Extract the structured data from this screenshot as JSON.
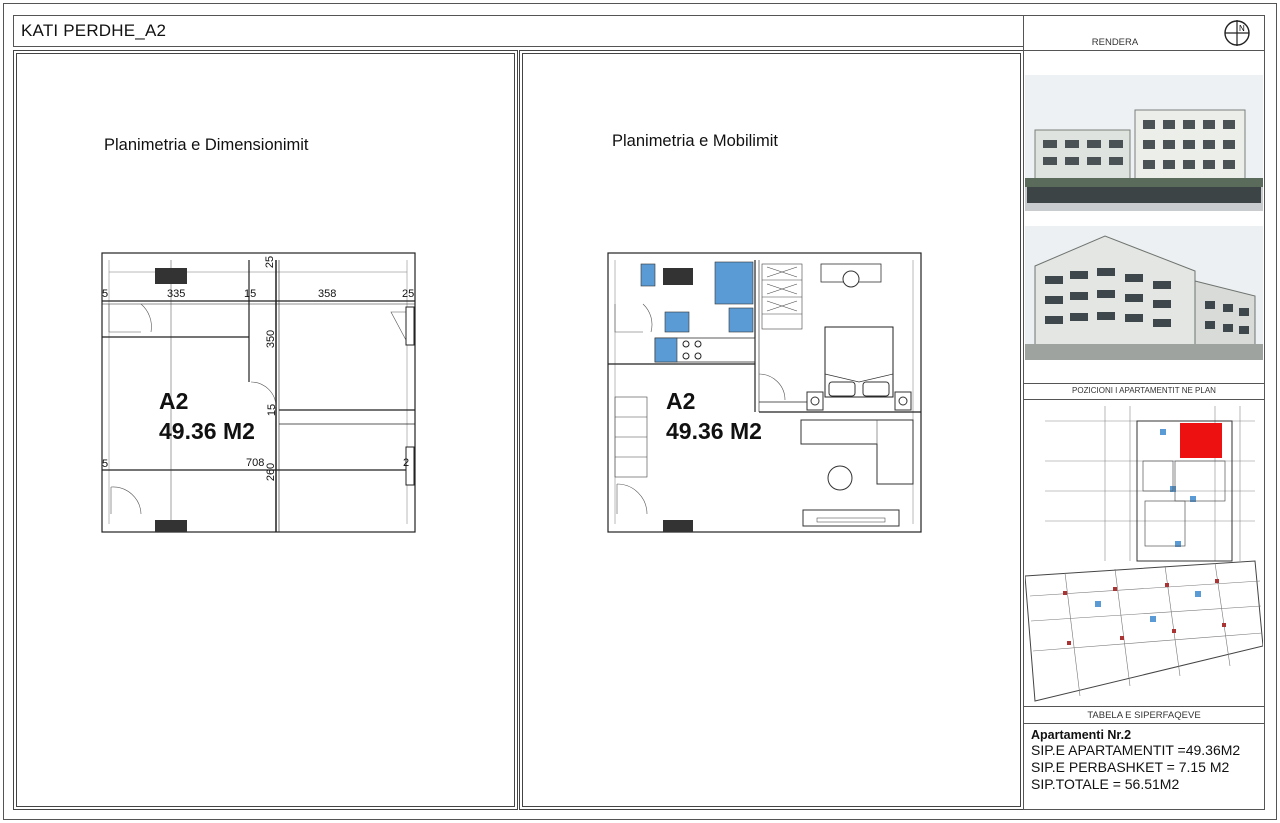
{
  "sheet": {
    "title": "KATI PERDHE_A2"
  },
  "plans": {
    "left": {
      "title": "Planimetria e Dimensionimit",
      "unit_name": "A2",
      "unit_area": "49.36 M2",
      "dimensions": {
        "d335": "335",
        "d15": "15",
        "d358": "358",
        "d5a": "5",
        "d25a": "25",
        "d25b": "25",
        "d350": "350",
        "d15v": "15",
        "d5b": "5",
        "d708": "708",
        "d260": "260",
        "d2c": "2"
      }
    },
    "right": {
      "title": "Planimetria e Mobilimit",
      "unit_name": "A2",
      "unit_area": "49.36 M2"
    }
  },
  "sidebar": {
    "header_label": "RENDERA",
    "north_symbol": "N",
    "position_label": "POZICIONI I APARTAMENTIT NE PLAN",
    "table_label": "TABELA E SIPERFAQEVE",
    "info": {
      "heading": "Apartamenti Nr.2",
      "line1": "SIP.E APARTAMENTIT =49.36M2",
      "line2": "SIP.E PERBASHKET = 7.15 M2",
      "line3": "SIP.TOTALE = 56.51M2"
    }
  },
  "colors": {
    "highlight": "#ee1111",
    "fixture_blue": "#5b9bd5",
    "sky": "#e9edf1",
    "building": "#eef0ec"
  },
  "icons": {
    "north": "north-arrow-icon"
  }
}
